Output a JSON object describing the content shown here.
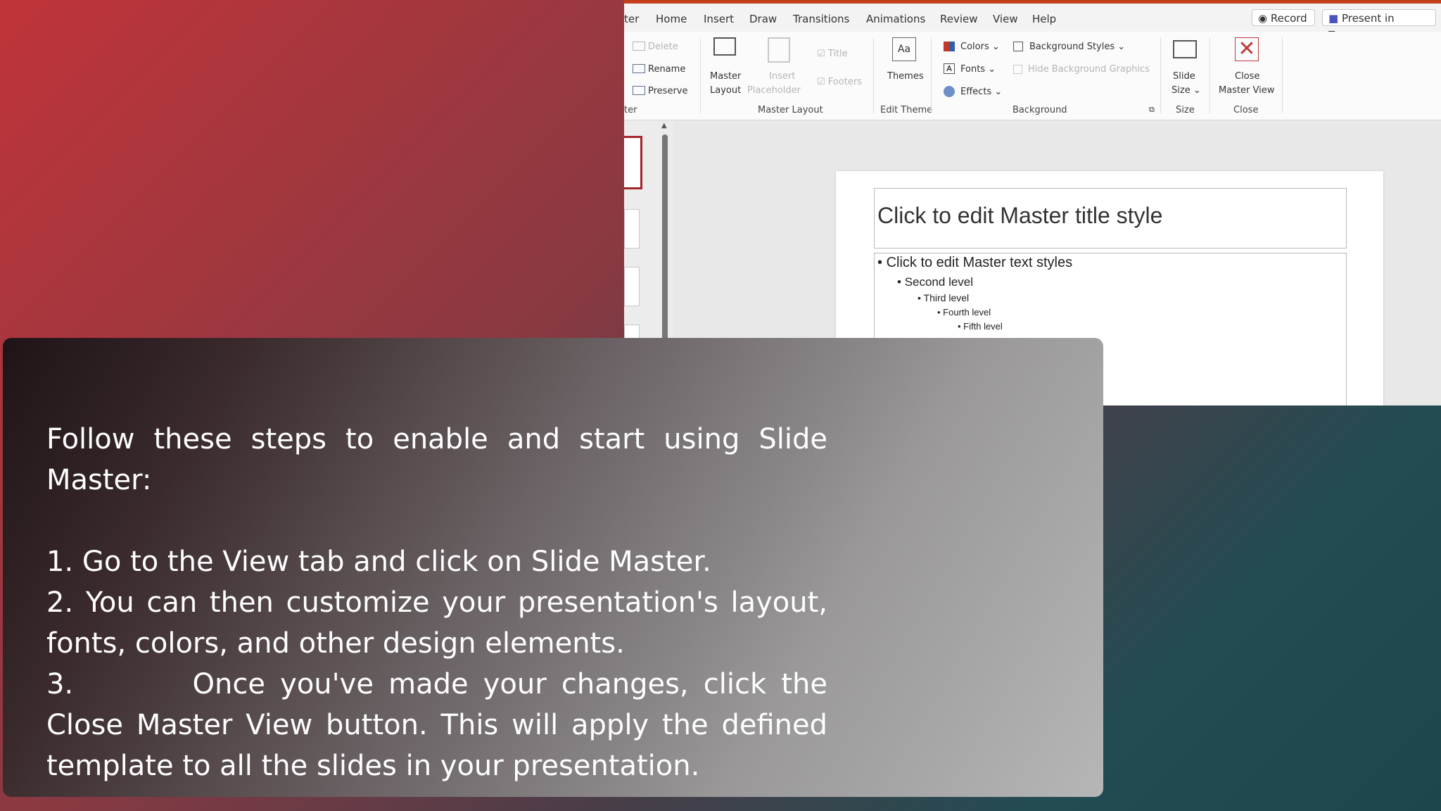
{
  "ribbon_tabs": [
    "ter",
    "Home",
    "Insert",
    "Draw",
    "Transitions",
    "Animations",
    "Review",
    "View",
    "Help"
  ],
  "ribbon_buttons": {
    "record": "Record",
    "present": "Present in Teams"
  },
  "ribbon": {
    "delete": "Delete",
    "rename": "Rename",
    "preserve": "Preserve",
    "group_master_partial": "ter",
    "master_layout_1": "Master",
    "master_layout_2": "Layout",
    "insert_ph_1": "Insert",
    "insert_ph_2": "Placeholder",
    "title": "Title",
    "footers": "Footers",
    "group_master_layout": "Master Layout",
    "themes": "Themes",
    "group_edit_theme": "Edit Theme",
    "colors": "Colors",
    "fonts": "Fonts",
    "effects": "Effects",
    "background_styles": "Background Styles",
    "hide_bg": "Hide Background Graphics",
    "group_background": "Background",
    "slide_size_1": "Slide",
    "slide_size_2": "Size",
    "group_size": "Size",
    "close_mv_1": "Close",
    "close_mv_2": "Master View",
    "group_close": "Close"
  },
  "slide": {
    "title": "Click to edit Master title style",
    "levels": [
      "Click to edit Master text styles",
      "Second level",
      "Third level",
      "Fourth level",
      "Fifth level"
    ]
  },
  "instructions": {
    "intro": "Follow these steps to enable and start using Slide Master:",
    "step1": "1. Go to the View tab and click on Slide Master.",
    "step2": "2. You can then customize your presentation's layout, fonts, colors, and other design elements.",
    "step3": "3.        Once you've made your changes, click the Close Master View button. This will apply the defined template to all the slides in your presentation."
  }
}
